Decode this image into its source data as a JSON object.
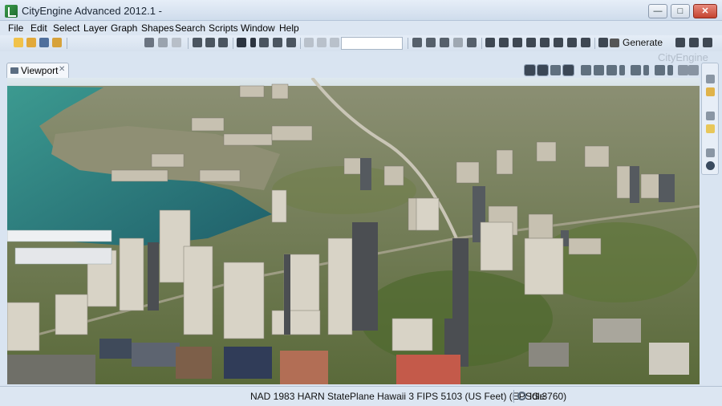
{
  "window": {
    "title": "CityEngine Advanced 2012.1 -",
    "min_glyph": "—",
    "max_glyph": "□",
    "close_glyph": "✕"
  },
  "menu": [
    "File",
    "Edit",
    "Select",
    "Layer",
    "Graph",
    "Shapes",
    "Search",
    "Scripts",
    "Window",
    "Help"
  ],
  "toolbar": {
    "search_value": "",
    "generate_label": "Generate",
    "brand_text": "CityEngine"
  },
  "viewport": {
    "tab_label": "Viewport",
    "tab_close_glyph": "✕",
    "scene_icon": "3d-city-scene"
  },
  "status": {
    "crs": "NAD 1983 HARN StatePlane Hawaii 3 FIPS 5103 (US Feet) (EPSG:3760)",
    "state": "Idle"
  },
  "colors": {
    "chrome": "#d9e4f1",
    "water": "#2f7f7a",
    "vegetation": "#5d7a3c",
    "urban": "#8a8a80",
    "building": "#c9c3b4"
  }
}
